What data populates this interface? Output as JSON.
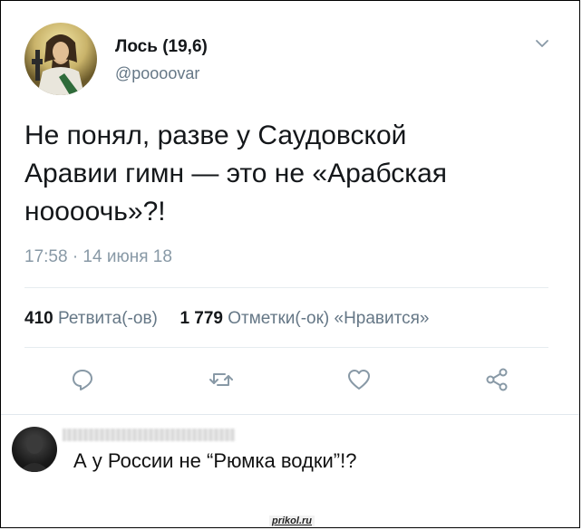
{
  "tweet": {
    "author_name": "Лось (19,6)",
    "author_handle": "@poooovar",
    "text": "Не понял, разве у Саудовской\nАравии гимн — это не «Арабская\nноооочь»?!",
    "timestamp": "17:58 · 14 июня 18",
    "retweets_count": "410",
    "retweets_label": "Ретвита(-ов)",
    "likes_count": "1 779",
    "likes_label": "Отметки(-ок) «Нравится»",
    "actions": {
      "reply": "reply-icon",
      "retweet": "retweet-icon",
      "like": "heart-icon",
      "share": "share-icon"
    }
  },
  "comment": {
    "text": "А у России не “Рюмка водки”!?"
  },
  "watermark": "prikol.ru",
  "colors": {
    "text_primary": "#14171a",
    "text_secondary": "#657786",
    "icon": "#8899a6",
    "divider": "#e6ecf0"
  }
}
